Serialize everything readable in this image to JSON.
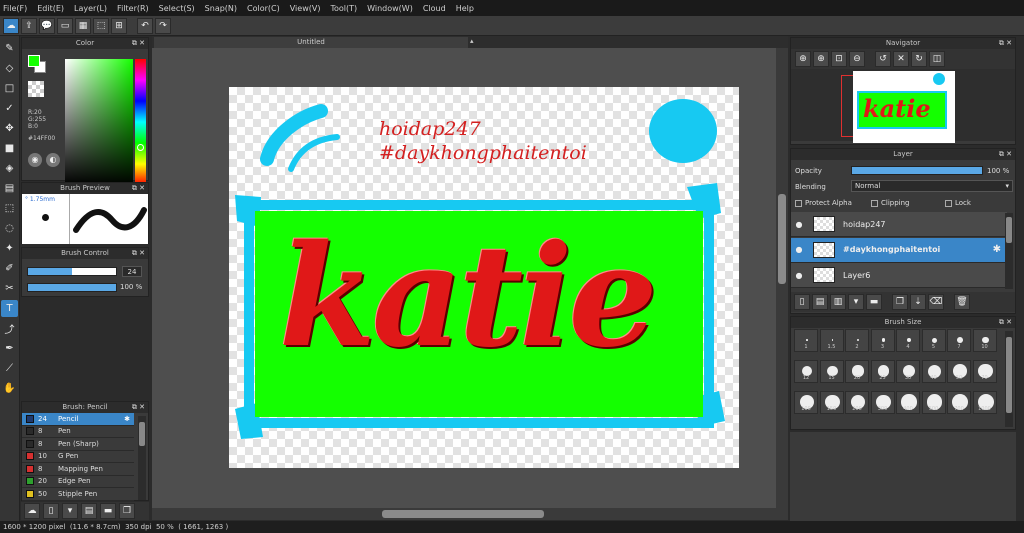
{
  "menu": [
    "File(F)",
    "Edit(E)",
    "Layer(L)",
    "Filter(R)",
    "Select(S)",
    "Snap(N)",
    "Color(C)",
    "View(V)",
    "Tool(T)",
    "Window(W)",
    "Cloud",
    "Help"
  ],
  "color_panel": {
    "title": "Color",
    "rgb_text": "R:20\nG:255\nB:0",
    "hex": "#14FF00",
    "fg_color": "#14ff00"
  },
  "brush_preview": {
    "title": "Brush Preview",
    "size": "1.75mm"
  },
  "brush_control": {
    "title": "Brush Control",
    "size_value": "24",
    "opacity_value": "100 %",
    "size_fraction": 0.5,
    "opacity_fraction": 1.0
  },
  "brush_list": {
    "title": "Brush: Pencil",
    "items": [
      {
        "size": "24",
        "name": "Pencil",
        "color": "#1e3a6e",
        "selected": true
      },
      {
        "size": "8",
        "name": "Pen",
        "color": "#2a2a2a"
      },
      {
        "size": "8",
        "name": "Pen (Sharp)",
        "color": "#2a2a2a"
      },
      {
        "size": "10",
        "name": "G Pen",
        "color": "#d63030"
      },
      {
        "size": "8",
        "name": "Mapping Pen",
        "color": "#d63030"
      },
      {
        "size": "20",
        "name": "Edge Pen",
        "color": "#2ea02e"
      },
      {
        "size": "50",
        "name": "Stipple Pen",
        "color": "#e0c020"
      }
    ]
  },
  "document": {
    "tab_title": "Untitled",
    "text_line1": "hoidap247",
    "text_line2": "#daykhongphaitentoi",
    "big_text": "katie"
  },
  "navigator": {
    "title": "Navigator"
  },
  "layer_panel": {
    "title": "Layer",
    "opacity_label": "Opacity",
    "opacity_value": "100 %",
    "blending_label": "Blending",
    "blending_value": "Normal",
    "protect_alpha": "Protect Alpha",
    "clipping": "Clipping",
    "lock": "Lock",
    "layers": [
      {
        "name": "hoidap247",
        "selected": false
      },
      {
        "name": "#daykhongphaitentoi",
        "selected": true
      },
      {
        "name": "Layer6",
        "selected": false
      }
    ]
  },
  "brush_size": {
    "title": "Brush Size",
    "sizes": [
      "1",
      "1.5",
      "2",
      "3",
      "4",
      "5",
      "7",
      "10",
      "12",
      "15",
      "20",
      "25",
      "30",
      "40",
      "50",
      "70",
      "100",
      "150",
      "200",
      "300",
      "400",
      "500",
      "700",
      "1000"
    ]
  },
  "status": {
    "dimensions": "1600 * 1200 pixel",
    "physical": "(11.6 * 8.7cm)",
    "dpi": "350 dpi",
    "zoom": "50 %",
    "coords": "( 1661, 1263 )"
  }
}
